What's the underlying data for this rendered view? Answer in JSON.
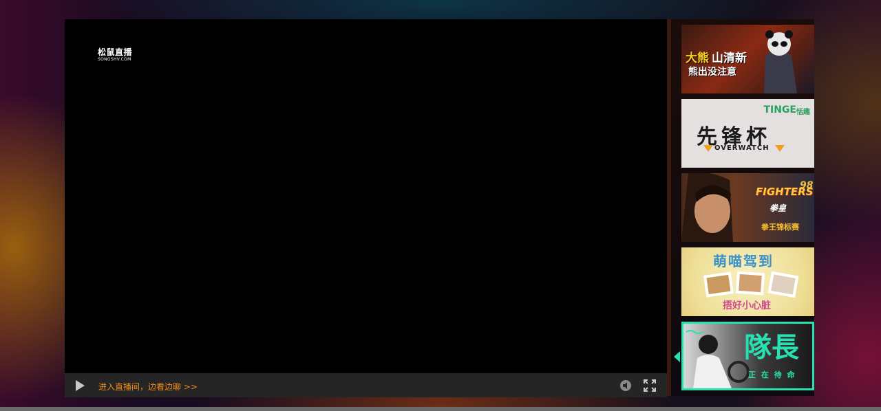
{
  "player": {
    "watermark_title": "松鼠直播",
    "watermark_sub": "SONGSHV.COM",
    "enter_link": "进入直播间，边看边聊 >>",
    "icons": {
      "play": "play-icon",
      "mute": "speaker-mute-icon",
      "fullscreen": "fullscreen-icon"
    },
    "colors": {
      "link": "#f08a1a",
      "control_bar": "#252525",
      "active_border": "#28e0b0"
    }
  },
  "sidebar": {
    "thumbs": [
      {
        "line1": "大熊",
        "line2": "山清新",
        "line3": "熊出没注意"
      },
      {
        "brand": "TINGE",
        "brand_cn": "恬趣",
        "title": "先锋杯",
        "sub": "OVERWATCH"
      },
      {
        "game": "FIGHTERS",
        "game_num": "98",
        "cn": "拳皇",
        "sub": "拳王锦标赛"
      },
      {
        "title": "萌喵驾到",
        "sub": "捂好小心脏"
      },
      {
        "title": "隊長",
        "sub": "正 在 待 命"
      }
    ]
  }
}
